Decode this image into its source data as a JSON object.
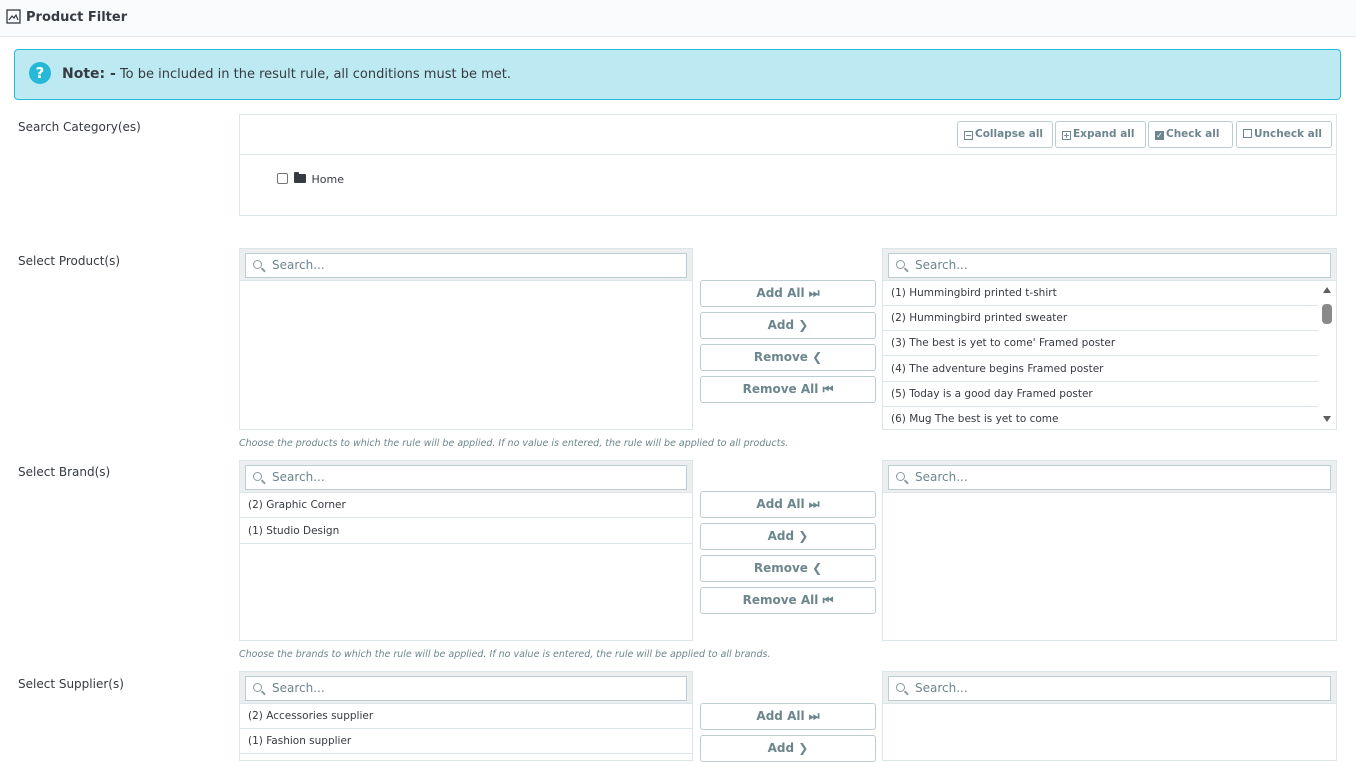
{
  "panel": {
    "title": "Product Filter",
    "icon": "image-icon"
  },
  "note": {
    "label": "Note: -",
    "text": "To be included in the result rule, all conditions must be met."
  },
  "category": {
    "label": "Search Category(es)",
    "toolbar": {
      "collapse_all": "Collapse all",
      "expand_all": "Expand all",
      "check_all": "Check all",
      "uncheck_all": "Uncheck all"
    },
    "tree": [
      {
        "label": "Home",
        "checked": false
      }
    ]
  },
  "products": {
    "label": "Select Product(s)",
    "left_search_placeholder": "Search...",
    "right_search_placeholder": "Search...",
    "available": [],
    "selected": [
      "(1) Hummingbird printed t-shirt",
      "(2) Hummingbird printed sweater",
      "(3) The best is yet to come' Framed poster",
      "(4) The adventure begins Framed poster",
      "(5) Today is a good day Framed poster",
      "(6) Mug The best is yet to come"
    ],
    "buttons": {
      "add_all": "Add All ⏭",
      "add": "Add ❯",
      "remove": "Remove ❮",
      "remove_all": "Remove All ⏮"
    },
    "hint": "Choose the products to which the rule will be applied. If no value is entered, the rule will be applied to all products."
  },
  "brands": {
    "label": "Select Brand(s)",
    "left_search_placeholder": "Search...",
    "right_search_placeholder": "Search...",
    "available": [
      "(2) Graphic Corner",
      "(1) Studio Design"
    ],
    "selected": [],
    "buttons": {
      "add_all": "Add All ⏭",
      "add": "Add ❯",
      "remove": "Remove ❮",
      "remove_all": "Remove All ⏮"
    },
    "hint": "Choose the brands to which the rule will be applied. If no value is entered, the rule will be applied to all brands."
  },
  "suppliers": {
    "label": "Select Supplier(s)",
    "left_search_placeholder": "Search...",
    "right_search_placeholder": "Search...",
    "available": [
      "(2) Accessories supplier",
      "(1) Fashion supplier"
    ],
    "selected": [],
    "buttons": {
      "add_all": "Add All ⏭",
      "add": "Add ❯"
    }
  }
}
